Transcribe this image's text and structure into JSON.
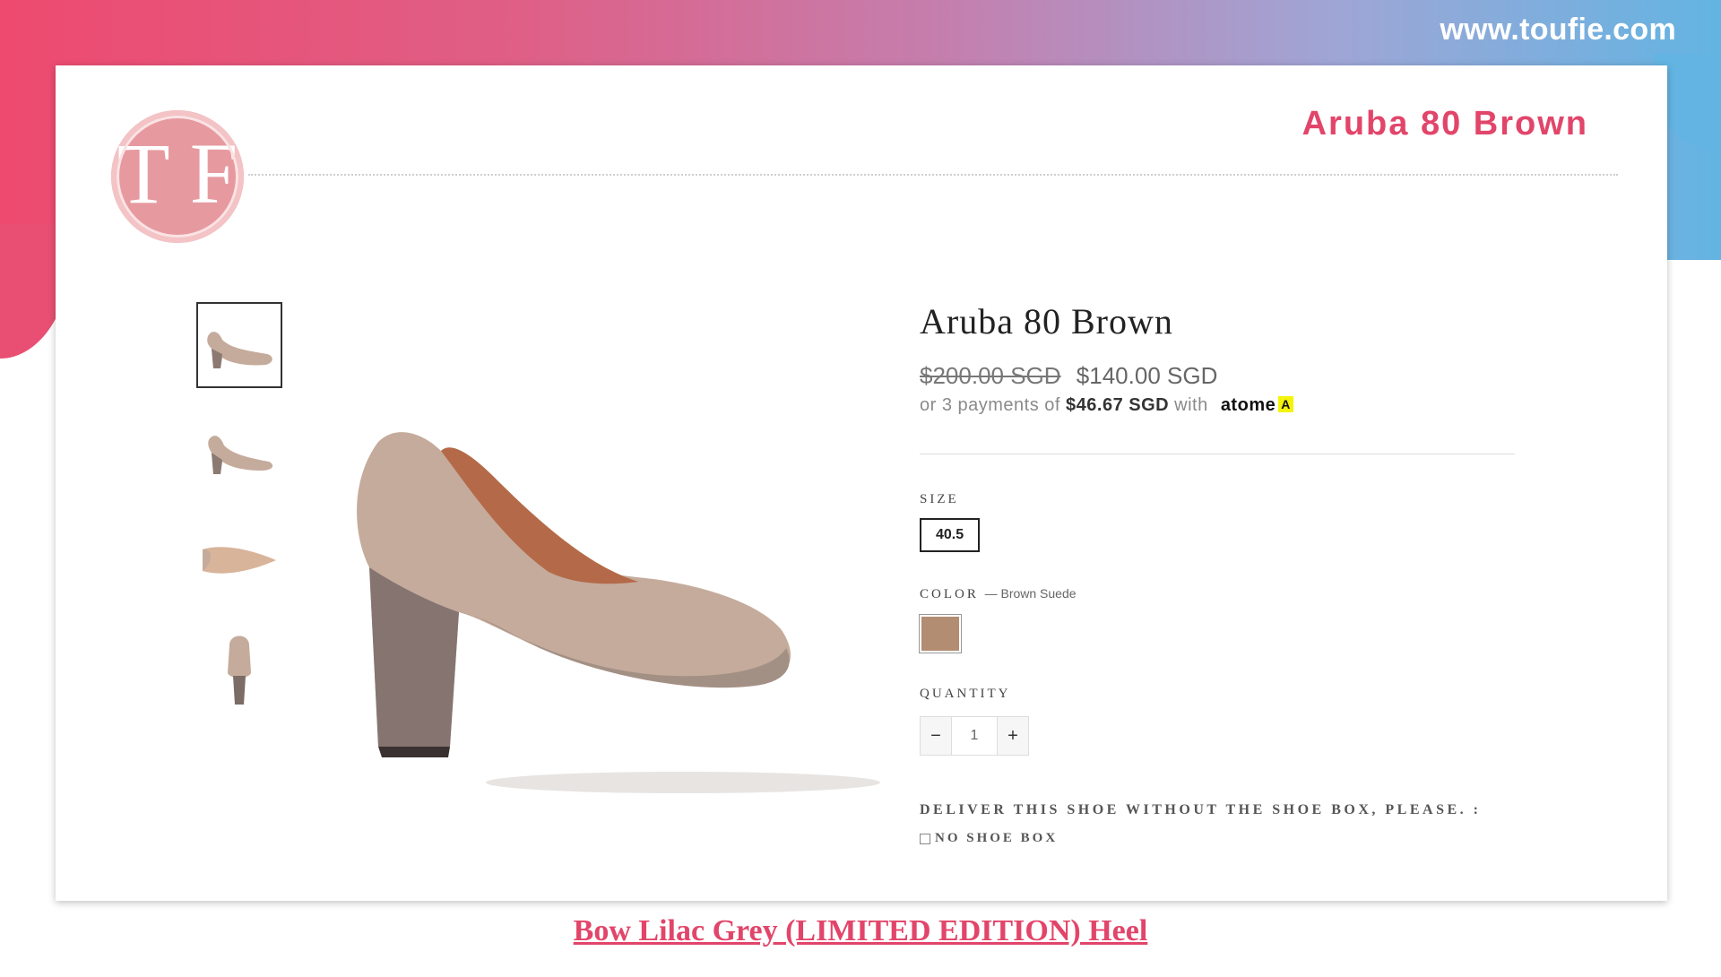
{
  "site": {
    "url": "www.toufie.com"
  },
  "header": {
    "logo_letter": "T F",
    "title": "Aruba 80 Brown"
  },
  "product": {
    "title": "Aruba 80 Brown",
    "price_old": "$200.00 SGD",
    "price_new": "$140.00 SGD",
    "installment": {
      "prefix": "or 3 payments of",
      "amount": "$46.67 SGD",
      "with": "with",
      "provider": "atome",
      "badge": "A"
    },
    "size": {
      "label": "SIZE",
      "selected": "40.5"
    },
    "color": {
      "label": "COLOR",
      "value": "— Brown Suede",
      "swatch": "#b38d72"
    },
    "quantity": {
      "label": "QUANTITY",
      "minus": "−",
      "value": "1",
      "plus": "+"
    },
    "delivery": {
      "label": "DELIVER THIS SHOE WITHOUT THE SHOE BOX, PLEASE. :",
      "option": "NO SHOE BOX"
    }
  },
  "thumbnails": [
    {
      "icon": "shoe-side-thumb"
    },
    {
      "icon": "shoe-angle-thumb"
    },
    {
      "icon": "shoe-sole-thumb"
    },
    {
      "icon": "shoe-back-thumb"
    }
  ],
  "footer": {
    "link": "Bow Lilac Grey (LIMITED EDITION) Heel"
  },
  "colors": {
    "accent": "#e2456a",
    "shoe": "#c5ab9c"
  }
}
